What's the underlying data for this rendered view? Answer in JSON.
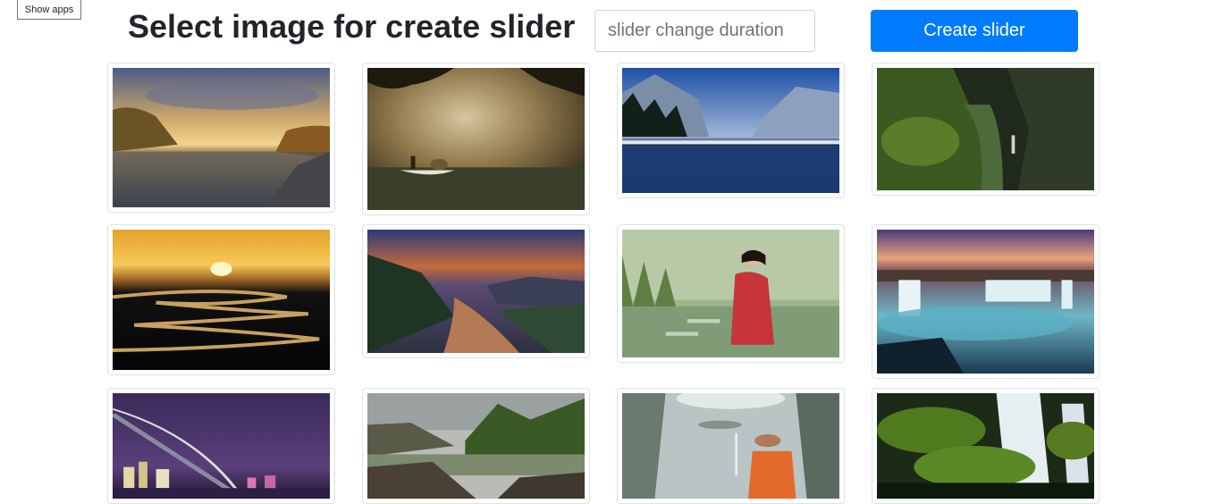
{
  "toolbar": {
    "show_apps_label": "Show apps"
  },
  "header": {
    "title": "Select image for create slider",
    "duration_placeholder": "slider change duration",
    "duration_value": "",
    "create_label": "Create slider"
  },
  "colors": {
    "accent": "#007bff",
    "thumb_border": "#dee2e6"
  },
  "gallery": {
    "images": [
      {
        "name": "sunset-lake-autumn-trees"
      },
      {
        "name": "boatman-in-foggy-sunbeams"
      },
      {
        "name": "snowy-mountain-lake-reflection"
      },
      {
        "name": "green-canyon-waterfall"
      },
      {
        "name": "sunset-winding-river"
      },
      {
        "name": "mountain-river-dusk"
      },
      {
        "name": "woman-in-red-in-pond"
      },
      {
        "name": "turquoise-waterfall-cliff"
      },
      {
        "name": "city-bridge-at-night"
      },
      {
        "name": "rocky-river-forest"
      },
      {
        "name": "child-pouring-water"
      },
      {
        "name": "mossy-rocks-waterfall"
      }
    ]
  }
}
